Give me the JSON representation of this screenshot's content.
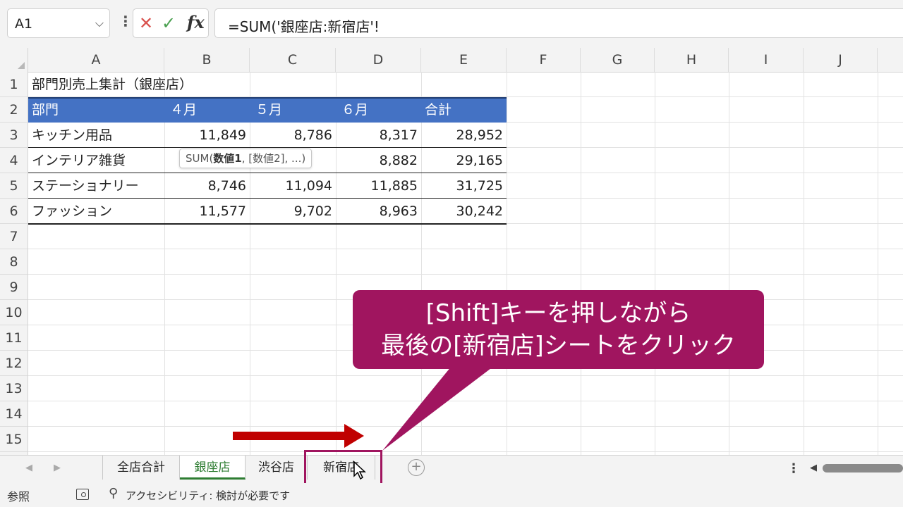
{
  "formula_bar": {
    "name_box": "A1",
    "formula": "=SUM('銀座店:新宿店'!"
  },
  "columns": [
    "A",
    "B",
    "C",
    "D",
    "E",
    "F",
    "G",
    "H",
    "I",
    "J"
  ],
  "rows": [
    "1",
    "2",
    "3",
    "4",
    "5",
    "6",
    "7",
    "8",
    "9",
    "10",
    "11",
    "12",
    "13",
    "14",
    "15"
  ],
  "sheet": {
    "title": "部門別売上集計（銀座店）",
    "headers": [
      "部門",
      "４月",
      "５月",
      "６月",
      "合計"
    ],
    "data": [
      [
        "キッチン用品",
        "11,849",
        "8,786",
        "8,317",
        "28,952"
      ],
      [
        "インテリア雑貨",
        "",
        "",
        "8,882",
        "29,165"
      ],
      [
        "ステーショナリー",
        "8,746",
        "11,094",
        "11,885",
        "31,725"
      ],
      [
        "ファッション",
        "11,577",
        "9,702",
        "8,963",
        "30,242"
      ]
    ]
  },
  "tooltip": {
    "prefix": "SUM(",
    "arg1": "数値1",
    "rest": ", [数値2], ...)"
  },
  "callout": {
    "line1": "[Shift]キーを押しながら",
    "line2": "最後の[新宿店]シートをクリック",
    "color": "#a0155f"
  },
  "sheet_tabs": {
    "tabs": [
      "全店合計",
      "銀座店",
      "渋谷店",
      "新宿店"
    ],
    "active": "銀座店",
    "active_color": "#2e7d32"
  },
  "status_bar": {
    "mode": "参照",
    "accessibility": "アクセシビリティ: 検討が必要です"
  },
  "colors": {
    "table_header_bg": "#4472c4",
    "arrow": "#c00000",
    "highlight": "#a0155f"
  }
}
